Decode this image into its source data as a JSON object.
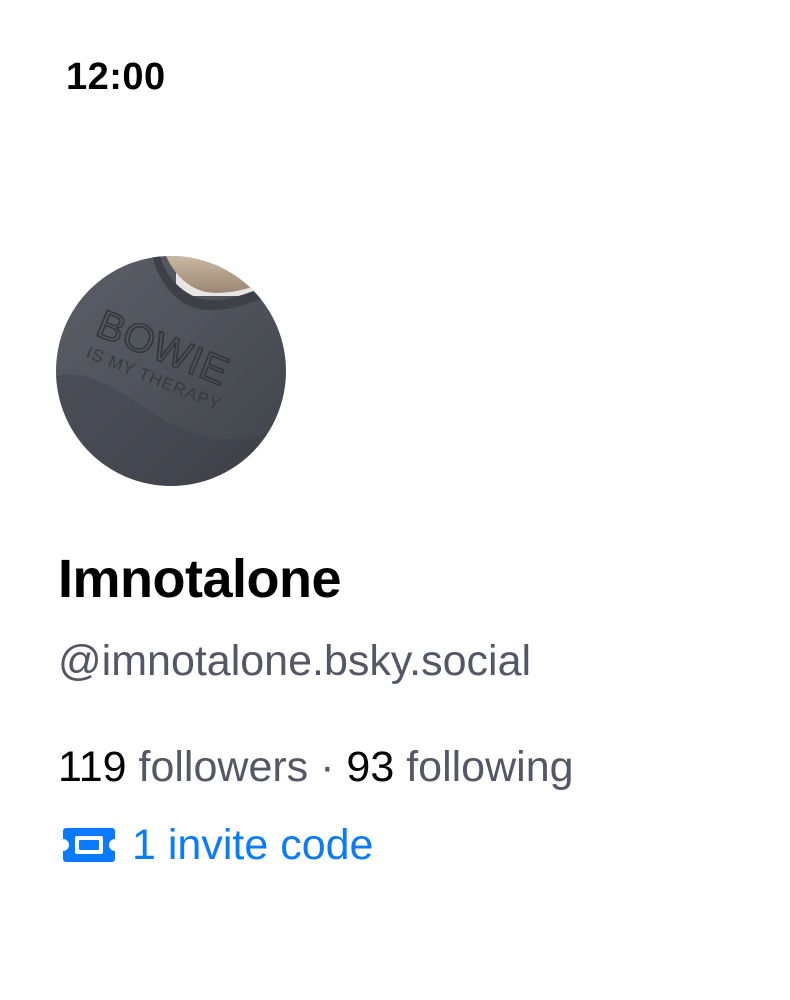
{
  "status_bar": {
    "time": "12:00"
  },
  "profile": {
    "avatar": {
      "shirt_text_main": "BOWIE",
      "shirt_text_sub": "IS MY THERAPY"
    },
    "display_name": "Imnotalone",
    "handle": "@imnotalone.bsky.social",
    "followers_count": "119",
    "followers_label": "followers",
    "separator": "·",
    "following_count": "93",
    "following_label": "following",
    "invite_label": "1 invite code",
    "invite_icon": "ticket-icon"
  },
  "colors": {
    "link": "#0a7aff",
    "secondary_text": "#545866",
    "primary_text": "#000000"
  }
}
